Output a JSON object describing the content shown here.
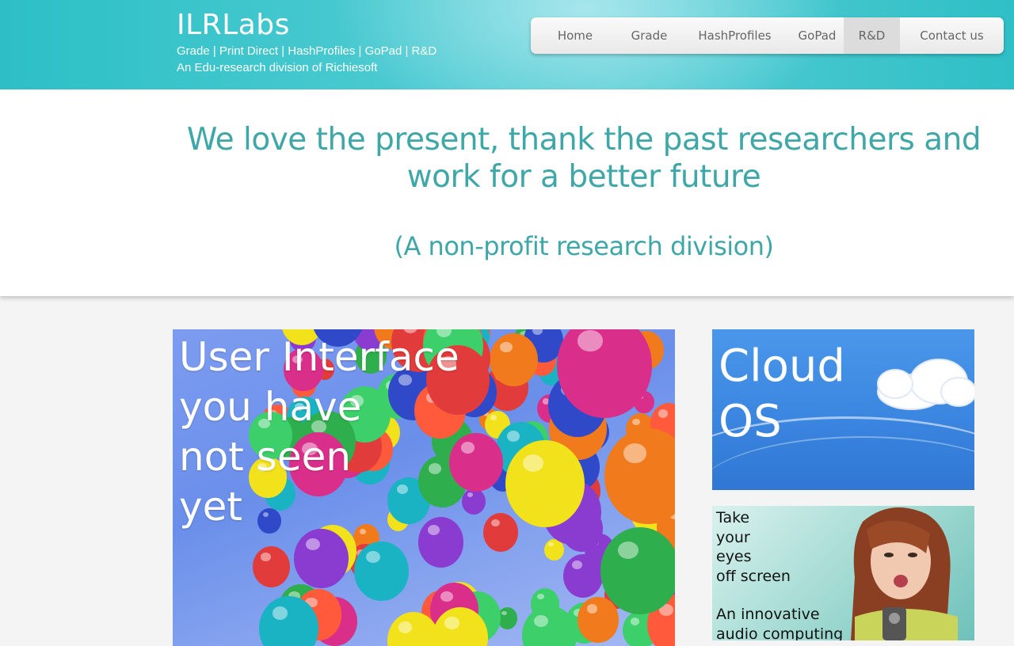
{
  "header": {
    "logo": "ILRLabs",
    "tagline": "Grade | Print Direct | HashProfiles | GoPad | R&D",
    "subtagline": "An Edu-research division of Richiesoft"
  },
  "nav": {
    "items": [
      {
        "label": "Home"
      },
      {
        "label": "Grade"
      },
      {
        "label": "HashProfiles"
      },
      {
        "label": "GoPad"
      },
      {
        "label": "R&D",
        "active": true
      },
      {
        "label": "Contact us"
      }
    ]
  },
  "hero": {
    "slogan_line1": "We love the present, thank the past researchers and",
    "slogan_line2": "work for a better future",
    "note": "(A non-profit research division)"
  },
  "cards": {
    "ui": {
      "line1": "User Interface",
      "line2": "you have",
      "line3": "not seen",
      "line4": "yet"
    },
    "cloud": {
      "line1": "Cloud",
      "line2": "OS"
    },
    "audio": {
      "line1": "Take",
      "line2": "your",
      "line3": "eyes",
      "line4": "off screen",
      "line5": "An innovative",
      "line6": "audio computing"
    }
  },
  "colors": {
    "header_teal": "#2cc0c6",
    "slogan_teal": "#3fa7a7",
    "nav_active": "#dcdcdc"
  }
}
